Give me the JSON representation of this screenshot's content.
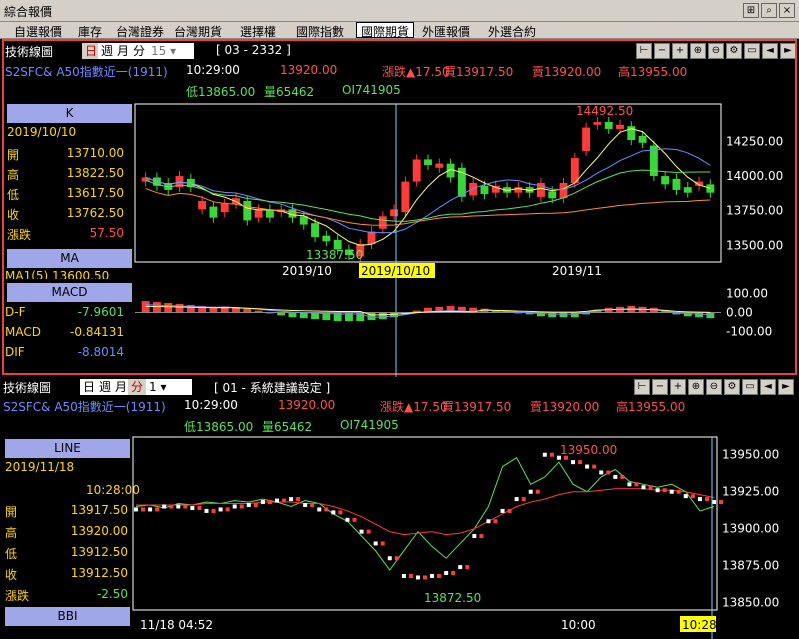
{
  "window": {
    "title": "綜合報價"
  },
  "tabs": [
    "自選報價",
    "庫存",
    "台灣證券",
    "台灣期貨",
    "選擇權",
    "國際指數",
    "國際期貨",
    "外匯報價",
    "外選合約"
  ],
  "active_tab": "國際期貨",
  "top": {
    "toolbar": {
      "label": "技術線圖",
      "periods": [
        "日",
        "週",
        "月",
        "分"
      ],
      "selected_period": "日",
      "count": "15",
      "code": "[ 03 - 2332 ]"
    },
    "quote": {
      "symbol": "S2SFC& A50指數近一(1911)",
      "time": "10:29:00",
      "price": "13920.00",
      "change": "漲跌▲17.50",
      "bid": "買13917.50",
      "ask": "賣13920.00",
      "high": "高13955.00",
      "low": "低13865.00",
      "volume": "量65462",
      "oi": "OI741905"
    },
    "k_panel": {
      "header": "K",
      "date": "2019/10/10",
      "rows": [
        {
          "label": "開",
          "value": "13710.00"
        },
        {
          "label": "高",
          "value": "13822.50"
        },
        {
          "label": "低",
          "value": "13617.50"
        },
        {
          "label": "收",
          "value": "13762.50"
        },
        {
          "label": "漲跌",
          "value": "57.50"
        }
      ]
    },
    "ma_panel": {
      "header": "MA",
      "row": "MA1(5)  13600.50"
    },
    "macd_panel": {
      "header": "MACD",
      "rows": [
        {
          "label": "D-F",
          "value": "-7.9601"
        },
        {
          "label": "MACD",
          "value": "-0.84131"
        },
        {
          "label": "DIF",
          "value": "-8.8014"
        }
      ]
    },
    "price_axis": [
      "14250.00",
      "14000.00",
      "13750.00",
      "13500.00"
    ],
    "high_label": "14492.50",
    "low_label": "13387.50",
    "date_axis": [
      "2019/10",
      "2019/10/10",
      "2019/11"
    ],
    "macd_axis": [
      "100.00",
      "0.00",
      "-100.00"
    ]
  },
  "bottom": {
    "toolbar": {
      "label": "技術線圖",
      "periods": [
        "日",
        "週",
        "月",
        "分"
      ],
      "selected_period": "分",
      "count": "1",
      "code": "[ 01 - 系統建議設定 ]"
    },
    "quote": {
      "symbol": "S2SFC& A50指數近一(1911)",
      "time": "10:29:00",
      "price": "13920.00",
      "change": "漲跌▲17.50",
      "bid": "買13917.50",
      "ask": "賣13920.00",
      "high": "高13955.00",
      "low": "低13865.00",
      "volume": "量65462",
      "oi": "OI741905"
    },
    "line_panel": {
      "header": "LINE",
      "date": "2019/11/18",
      "time": "10:28:00",
      "rows": [
        {
          "label": "開",
          "value": "13917.50"
        },
        {
          "label": "高",
          "value": "13920.00"
        },
        {
          "label": "低",
          "value": "13912.50"
        },
        {
          "label": "收",
          "value": "13912.50"
        },
        {
          "label": "漲跌",
          "value": "-2.50"
        }
      ]
    },
    "bbi_header": "BBI",
    "price_axis": [
      "13950.00",
      "13925.00",
      "13900.00",
      "13875.00",
      "13850.00"
    ],
    "high_label": "13950.00",
    "low_label": "13872.50",
    "time_axis": [
      "11/18 04:52",
      "10:00",
      "10:28"
    ]
  },
  "chart_data": [
    {
      "type": "candlestick",
      "title": "A50指數近一 日線",
      "x_labels": [
        "2019/10",
        "2019/10/10",
        "2019/11"
      ],
      "ylim": [
        13380,
        14520
      ],
      "candles": [
        {
          "o": 13960,
          "c": 13990
        },
        {
          "o": 13990,
          "c": 13930
        },
        {
          "o": 13950,
          "c": 13900
        },
        {
          "o": 13920,
          "c": 14000
        },
        {
          "o": 13980,
          "c": 13920
        },
        {
          "o": 13760,
          "c": 13820
        },
        {
          "o": 13780,
          "c": 13700
        },
        {
          "o": 13740,
          "c": 13800
        },
        {
          "o": 13800,
          "c": 13840
        },
        {
          "o": 13820,
          "c": 13680
        },
        {
          "o": 13700,
          "c": 13760
        },
        {
          "o": 13760,
          "c": 13700
        },
        {
          "o": 13740,
          "c": 13760
        },
        {
          "o": 13760,
          "c": 13700
        },
        {
          "o": 13710,
          "c": 13650
        },
        {
          "o": 13660,
          "c": 13560
        },
        {
          "o": 13570,
          "c": 13530
        },
        {
          "o": 13540,
          "c": 13470
        },
        {
          "o": 13470,
          "c": 13430
        },
        {
          "o": 13420,
          "c": 13510
        },
        {
          "o": 13510,
          "c": 13600
        },
        {
          "o": 13620,
          "c": 13710
        },
        {
          "o": 13710,
          "c": 13760
        },
        {
          "o": 13740,
          "c": 13960
        },
        {
          "o": 13960,
          "c": 14120
        },
        {
          "o": 14120,
          "c": 14080
        },
        {
          "o": 14060,
          "c": 14090
        },
        {
          "o": 14090,
          "c": 13990
        },
        {
          "o": 14060,
          "c": 13850
        },
        {
          "o": 13860,
          "c": 13950
        },
        {
          "o": 13930,
          "c": 13870
        },
        {
          "o": 13880,
          "c": 13930
        },
        {
          "o": 13920,
          "c": 13880
        },
        {
          "o": 13880,
          "c": 13920
        },
        {
          "o": 13920,
          "c": 13880
        },
        {
          "o": 13850,
          "c": 13950
        },
        {
          "o": 13890,
          "c": 13840
        },
        {
          "o": 13840,
          "c": 13950
        },
        {
          "o": 13950,
          "c": 14130
        },
        {
          "o": 14180,
          "c": 14350
        },
        {
          "o": 14370,
          "c": 14390
        },
        {
          "o": 14390,
          "c": 14340
        },
        {
          "o": 14340,
          "c": 14370
        },
        {
          "o": 14360,
          "c": 14260
        },
        {
          "o": 14290,
          "c": 14240
        },
        {
          "o": 14220,
          "c": 14000
        },
        {
          "o": 14000,
          "c": 13940
        },
        {
          "o": 13980,
          "c": 13900
        },
        {
          "o": 13920,
          "c": 13880
        },
        {
          "o": 13930,
          "c": 13960
        },
        {
          "o": 13940,
          "c": 13880
        }
      ]
    },
    {
      "type": "bar",
      "title": "MACD",
      "ylim": [
        -150,
        150
      ],
      "values": [
        60,
        55,
        50,
        45,
        40,
        35,
        30,
        32,
        28,
        20,
        10,
        -5,
        -15,
        -25,
        -30,
        -35,
        -40,
        -45,
        -45,
        -45,
        -40,
        -35,
        -25,
        -10,
        10,
        25,
        30,
        35,
        30,
        25,
        20,
        10,
        5,
        -5,
        -10,
        -20,
        -25,
        -25,
        -25,
        -10,
        15,
        25,
        30,
        35,
        30,
        25,
        10,
        -10,
        -20,
        -25,
        -30
      ]
    },
    {
      "type": "line",
      "title": "A50指數近一 1分線",
      "x_labels": [
        "11/18 04:52",
        "10:00",
        "10:28"
      ],
      "ylim": [
        13845,
        13962
      ],
      "series": [
        {
          "name": "price",
          "values": [
            13915,
            13916,
            13914,
            13917,
            13916,
            13918,
            13917,
            13919,
            13918,
            13920,
            13918,
            13915,
            13919,
            13917,
            13910,
            13905,
            13895,
            13885,
            13872,
            13885,
            13898,
            13888,
            13880,
            13890,
            13900,
            13915,
            13942,
            13948,
            13930,
            13935,
            13945,
            13930,
            13925,
            13935,
            13940,
            13932,
            13930,
            13928,
            13930,
            13925,
            13912,
            13915
          ]
        },
        {
          "name": "ma",
          "values": [
            13916,
            13916,
            13916,
            13916,
            13916,
            13917,
            13917,
            13917,
            13917,
            13918,
            13918,
            13918,
            13917,
            13917,
            13915,
            13912,
            13908,
            13903,
            13898,
            13896,
            13897,
            13898,
            13896,
            13897,
            13900,
            13905,
            13910,
            13915,
            13918,
            13920,
            13923,
            13925,
            13925,
            13926,
            13927,
            13927,
            13927,
            13926,
            13926,
            13925,
            13923,
            13921
          ]
        }
      ],
      "sar": [
        13913,
        13913,
        13915,
        13915,
        13914,
        13912,
        13913,
        13915,
        13916,
        13918,
        13919,
        13920,
        13916,
        13913,
        13911,
        13906,
        13898,
        13890,
        13880,
        13868,
        13867,
        13868,
        13870,
        13874,
        13895,
        13905,
        13912,
        13920,
        13925,
        13950,
        13948,
        13945,
        13942,
        13938,
        13935,
        13930,
        13928,
        13926,
        13925,
        13922,
        13920,
        13918
      ]
    }
  ]
}
